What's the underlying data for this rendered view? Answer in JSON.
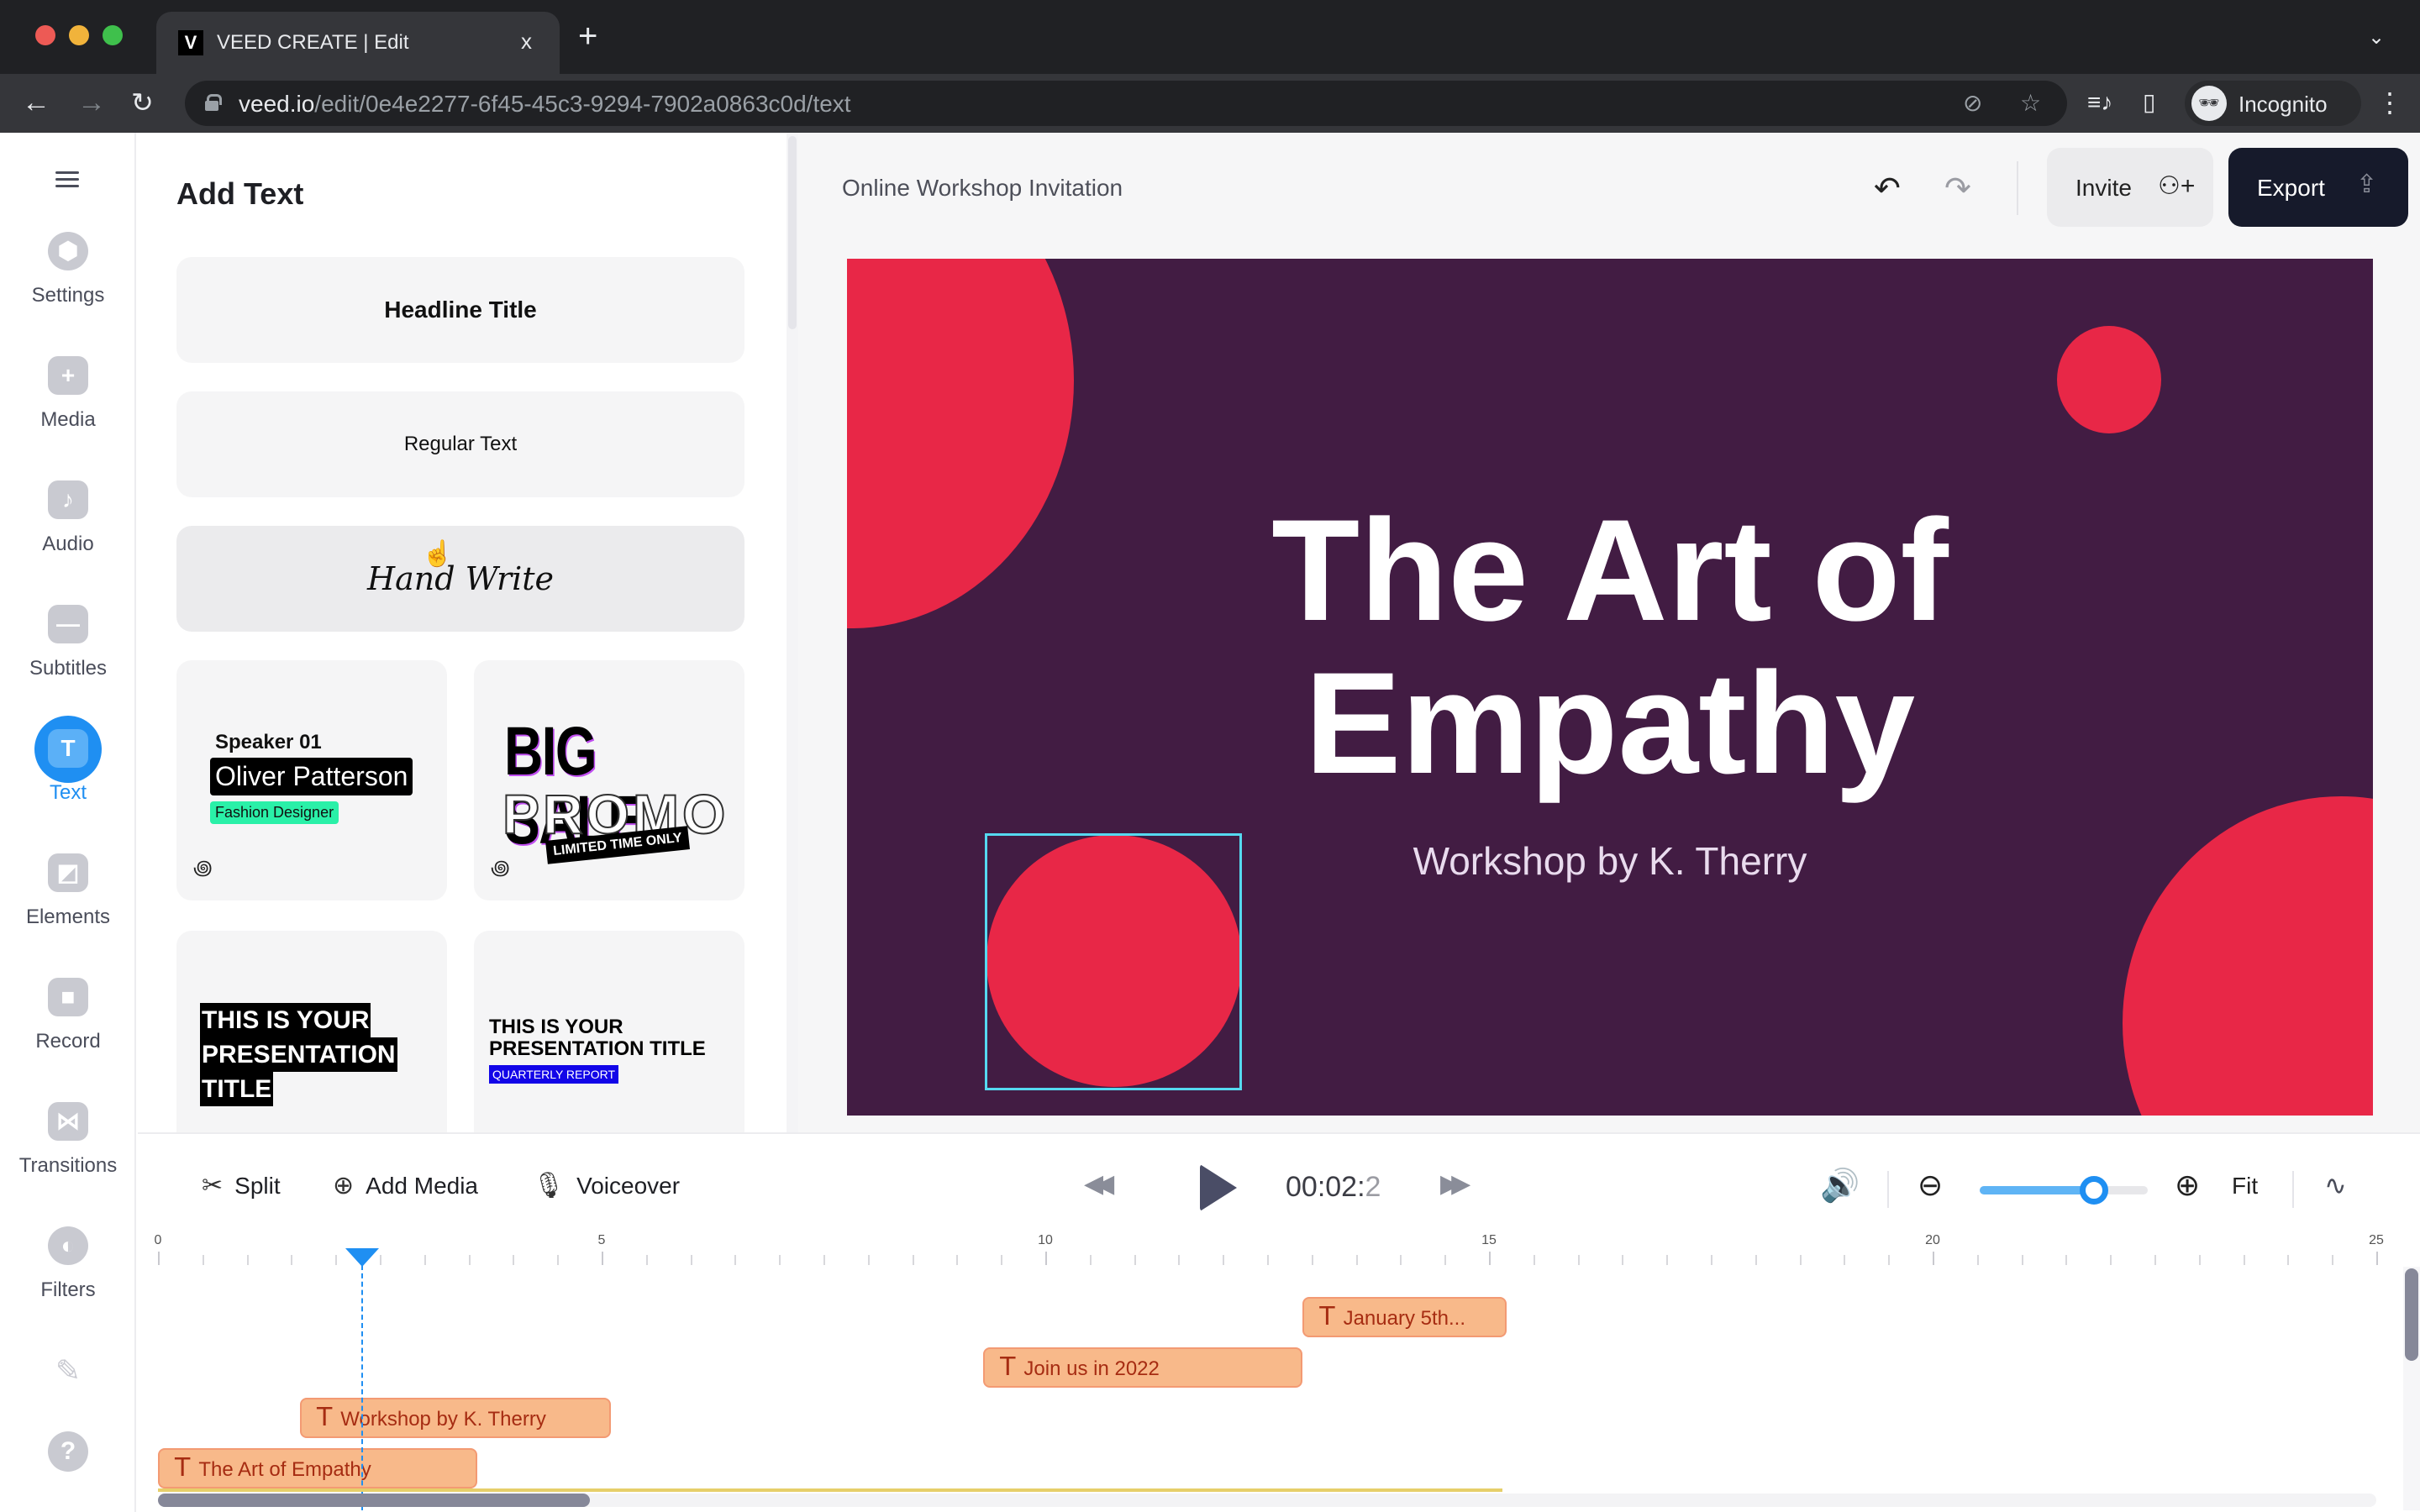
{
  "browser": {
    "tab_title": "VEED CREATE | Edit",
    "tab_favicon": "V",
    "tab_close": "x",
    "new_tab": "+",
    "url_host": "veed.io",
    "url_path": "/edit/0e4e2277-6f45-45c3-9294-7902a0863c0d/text",
    "profile_label": "Incognito",
    "icons": {
      "back": "←",
      "forward": "→",
      "reload": "↻",
      "eye_off": "⊘",
      "star": "☆",
      "media": "≡♪",
      "side_panel": "▯",
      "incognito": "🕶",
      "menu": "⋮",
      "tabs_menu": "⌄"
    }
  },
  "sidebar": {
    "items": [
      {
        "id": "settings",
        "label": "Settings",
        "icon": "⬢"
      },
      {
        "id": "media",
        "label": "Media",
        "icon": "+"
      },
      {
        "id": "audio",
        "label": "Audio",
        "icon": "♪"
      },
      {
        "id": "subtitles",
        "label": "Subtitles",
        "icon": "—"
      },
      {
        "id": "text",
        "label": "Text",
        "icon": "T",
        "active": true
      },
      {
        "id": "elements",
        "label": "Elements",
        "icon": "◩"
      },
      {
        "id": "record",
        "label": "Record",
        "icon": "■"
      },
      {
        "id": "transitions",
        "label": "Transitions",
        "icon": "⋈"
      },
      {
        "id": "filters",
        "label": "Filters",
        "icon": "◐"
      }
    ],
    "pen_icon": "✎",
    "help_icon": "?"
  },
  "panel": {
    "title": "Add Text",
    "buttons": {
      "headline": "Headline Title",
      "regular": "Regular Text",
      "handwrite": "Hand Write"
    },
    "presets": {
      "speaker": {
        "sub": "Speaker 01",
        "name": "Oliver Patterson",
        "role": "Fashion Designer"
      },
      "sale": {
        "line1": "BIG SALE",
        "line2": "PROMO",
        "tag": "LIMITED TIME ONLY"
      },
      "presentation1": {
        "line1": "THIS IS YOUR",
        "line2": "PRESENTATION",
        "line3": "TITLE"
      },
      "presentation2": {
        "line1": "THIS IS YOUR",
        "line2": "PRESENTATION TITLE",
        "tag": "QUARTERLY REPORT"
      }
    },
    "anim_icon": "꩜"
  },
  "editor": {
    "project_title": "Online Workshop Invitation",
    "undo_icon": "↶",
    "redo_icon": "↷",
    "invite_label": "Invite",
    "invite_icon": "⚇+",
    "export_label": "Export",
    "export_icon": "⇪",
    "canvas": {
      "background": "#421c43",
      "accent": "#e82747",
      "headline_line1": "The Art of",
      "headline_line2": "Empathy",
      "subtitle": "Workshop by K. Therry"
    }
  },
  "timeline": {
    "tools": {
      "split": "Split",
      "split_icon": "✂",
      "add_media": "Add Media",
      "add_media_icon": "⊕",
      "voiceover": "Voiceover",
      "voiceover_icon": "🎙"
    },
    "rewind_icon": "◀◀",
    "forward_icon": "▶▶",
    "time_main": "00:02:",
    "time_frac": "2",
    "volume_icon": "🔊",
    "zoom_out_icon": "⊖",
    "zoom_in_icon": "⊕",
    "zoom_level": 0.68,
    "fit_label": "Fit",
    "waveform_icon": "∿",
    "ruler": {
      "min": 0,
      "max": 25,
      "major_every": 5,
      "minor_per_second": 2,
      "labels": [
        "0",
        "5",
        "10",
        "15",
        "20",
        "25"
      ]
    },
    "playhead_seconds": 2.3,
    "clips": [
      {
        "label": "January 5th...",
        "start": 12.9,
        "end": 15.2,
        "row": 0
      },
      {
        "label": "Join us in 2022",
        "start": 9.3,
        "end": 12.9,
        "row": 1
      },
      {
        "label": "Workshop by K. Therry",
        "start": 1.6,
        "end": 5.1,
        "row": 2
      },
      {
        "label": "The Art of Empathy",
        "start": 0.0,
        "end": 3.6,
        "row": 3
      }
    ],
    "clip_icon": "T",
    "scroll_position": 0.0,
    "scroll_visible_fraction": 0.19
  }
}
